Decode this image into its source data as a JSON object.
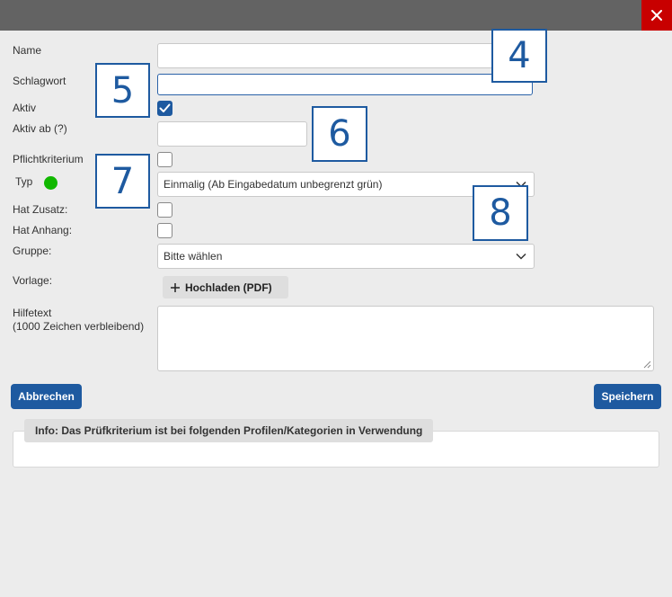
{
  "dialog": {
    "close_label": "×"
  },
  "form": {
    "name_label": "Name",
    "schlagwort_label": "Schlagwort",
    "aktiv_label": "Aktiv",
    "aktiv_checked": true,
    "aktiv_ab_label": "Aktiv ab (?)",
    "pflicht_label": "Pflichtkriterium",
    "pflicht_checked": false,
    "typ_label": "Typ",
    "typ_status_color": "#11b800",
    "typ_value": "Einmalig (Ab Eingabedatum unbegrenzt grün)",
    "zusatz_label": "Hat Zusatz:",
    "zusatz_checked": false,
    "anhang_label": "Hat Anhang:",
    "anhang_checked": false,
    "gruppe_label": "Gruppe:",
    "gruppe_value": "Bitte wählen",
    "vorlage_label": "Vorlage:",
    "upload_label": "Hochladen (PDF)",
    "hilfetext_label": "Hilfetext",
    "hilfetext_hint": "(1000 Zeichen verbleibend)"
  },
  "actions": {
    "cancel_label": "Abbrechen",
    "save_label": "Speichern"
  },
  "info": {
    "title": "Info: Das Prüfkriterium ist bei folgenden Profilen/Kategorien in Verwendung"
  },
  "callouts": [
    "4",
    "5",
    "6",
    "7",
    "8"
  ],
  "colors": {
    "accent": "#1e5aa0",
    "close": "#c80000",
    "titlebar": "#636363"
  }
}
